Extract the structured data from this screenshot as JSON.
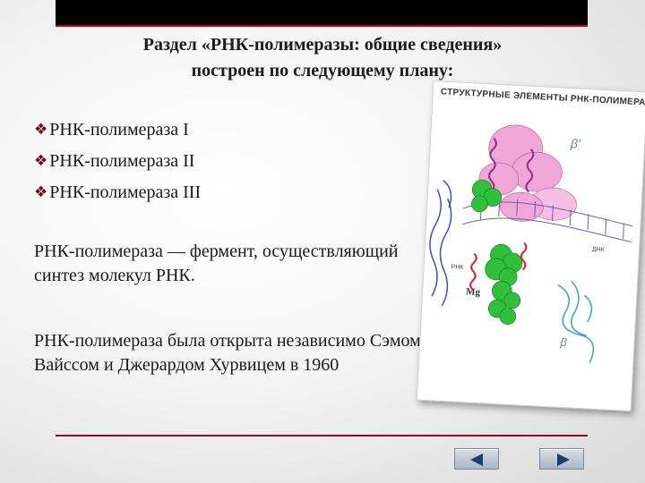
{
  "slide": {
    "title": "Раздел «РНК-полимеразы: общие сведения» построен по следующему плану:",
    "bullets": [
      "РНК-полимераза I",
      "РНК-полимераза II",
      "РНК-полимераза III"
    ],
    "paragraph_1": "РНК-полимераза — фермент, осуществляющий синтез молекул РНК.",
    "paragraph_2": "РНК-полимераза была открыта независимо Сэмом Вайссом и Джерардом Хурвицем в 1960"
  },
  "figure": {
    "title": "СТРУКТУРНЫЕ ЭЛЕМЕНТЫ РНК-ПОЛИМЕРАЗЫ",
    "labels": {
      "beta_prime": "β′",
      "beta": "β",
      "mg": "Mg",
      "rnk": "РНК",
      "dnk": "ДНК"
    }
  },
  "navigation": {
    "prev_icon": "triangle-left-icon",
    "next_icon": "triangle-right-icon"
  },
  "colors": {
    "top_bar": "#000000",
    "accent_line": "#c0001e",
    "bullet": "#6d0a17",
    "nav_arrow": "#1f3a66"
  }
}
